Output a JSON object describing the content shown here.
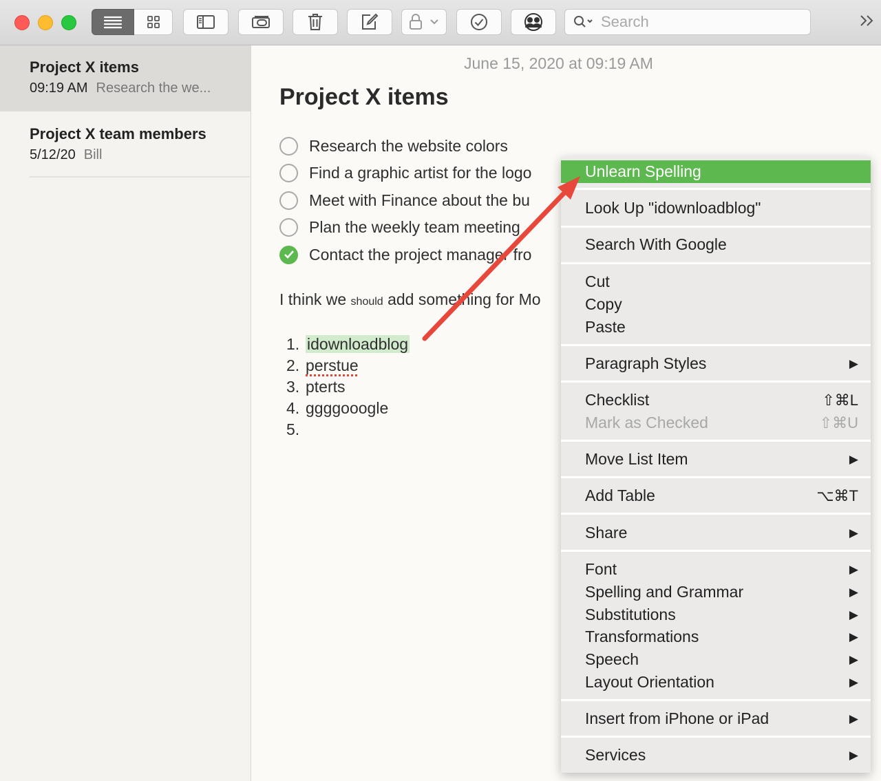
{
  "search": {
    "placeholder": "Search"
  },
  "sidebar": {
    "notes": [
      {
        "title": "Project X items",
        "time": "09:19 AM",
        "snippet": "Research the we..."
      },
      {
        "title": "Project X team members",
        "time": "5/12/20",
        "snippet": "Bill"
      }
    ]
  },
  "editor": {
    "date": "June 15, 2020 at 09:19 AM",
    "title": "Project X items",
    "checklist": [
      {
        "text": "Research the website colors",
        "checked": false
      },
      {
        "text": "Find a graphic artist for the logo",
        "checked": false
      },
      {
        "text": "Meet with Finance about the bu",
        "checked": false
      },
      {
        "text": "Plan the weekly team meeting",
        "checked": false
      },
      {
        "text": "Contact the project manager fro",
        "checked": true
      }
    ],
    "paragraph": {
      "before": "I think we ",
      "small": "should",
      "after": " add something for Mo"
    },
    "numbered": [
      {
        "num": "1.",
        "text": "idownloadblog"
      },
      {
        "num": "2.",
        "text": "perstue"
      },
      {
        "num": "3.",
        "text": "pterts"
      },
      {
        "num": "4.",
        "text": "ggggooogle"
      },
      {
        "num": "5.",
        "text": ""
      }
    ]
  },
  "context_menu": {
    "unlearn": "Unlearn Spelling",
    "lookup": "Look Up \"idownloadblog\"",
    "search_google": "Search With Google",
    "cut": "Cut",
    "copy": "Copy",
    "paste": "Paste",
    "paragraph_styles": "Paragraph Styles",
    "checklist": "Checklist",
    "checklist_shortcut": "⇧⌘L",
    "mark_checked": "Mark as Checked",
    "mark_checked_shortcut": "⇧⌘U",
    "move_list_item": "Move List Item",
    "add_table": "Add Table",
    "add_table_shortcut": "⌥⌘T",
    "share": "Share",
    "font": "Font",
    "spelling_grammar": "Spelling and Grammar",
    "substitutions": "Substitutions",
    "transformations": "Transformations",
    "speech": "Speech",
    "layout_orientation": "Layout Orientation",
    "insert_iphone": "Insert from iPhone or iPad",
    "services": "Services",
    "submenu_arrow": "▶"
  },
  "colors": {
    "accent_green": "#5cb84f",
    "annotation_arrow": "#e8473c"
  }
}
